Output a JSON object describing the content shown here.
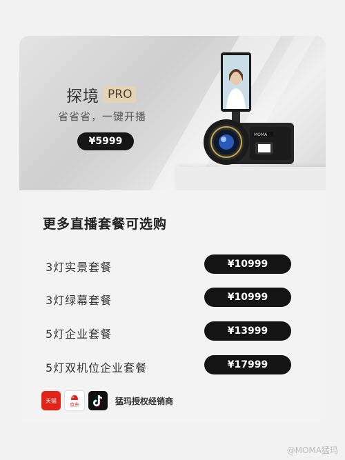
{
  "hero": {
    "product_name": "探境",
    "product_badge": "PRO",
    "slogan": "省省省，一键开播",
    "price": "¥5999",
    "brand_on_camera": "MOMA"
  },
  "packages": {
    "section_title": "更多直播套餐可选购",
    "items": [
      {
        "label": "3灯实景套餐",
        "price": "¥10999"
      },
      {
        "label": "3灯绿幕套餐",
        "price": "¥10999"
      },
      {
        "label": "5灯企业套餐",
        "price": "¥13999"
      },
      {
        "label": "5灯双机位企业套餐",
        "price": "¥17999"
      }
    ]
  },
  "footer": {
    "tmall_label": "天猫",
    "jd_label": "京东",
    "dealer_text": "猛玛授权经销商",
    "icons": [
      "tmall-icon",
      "jd-icon",
      "douyin-icon"
    ]
  },
  "watermark": "@MOMA猛玛",
  "colors": {
    "pill": "#141414",
    "badge": "#e4d3b4",
    "tmall": "#e2231a"
  }
}
